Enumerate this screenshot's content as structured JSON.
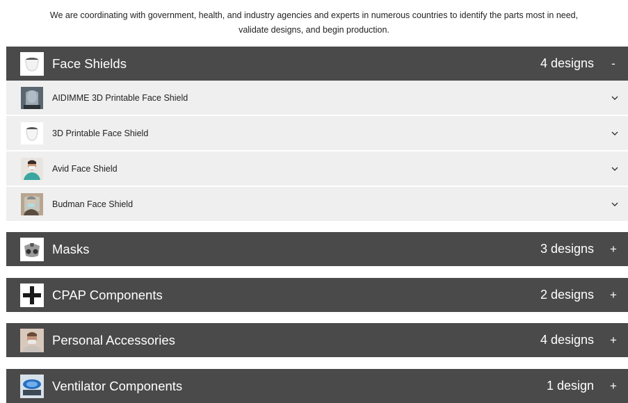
{
  "intro": {
    "line1": "We are coordinating with government, health, and industry agencies and experts in numerous countries to identify the parts most in need,",
    "line2": "validate designs, and begin production."
  },
  "categories": [
    {
      "title": "Face Shields",
      "count": "4 designs",
      "toggle": "-",
      "expanded": true,
      "icon": "face-shield-thumbnail",
      "items": [
        {
          "title": "AIDIMME 3D Printable Face Shield",
          "icon": "person-face-shield-photo"
        },
        {
          "title": "3D Printable Face Shield",
          "icon": "face-shield-thumbnail"
        },
        {
          "title": "Avid Face Shield",
          "icon": "person-mask-photo"
        },
        {
          "title": "Budman Face Shield",
          "icon": "person-face-shield-photo"
        }
      ]
    },
    {
      "title": "Masks",
      "count": "3 designs",
      "toggle": "+",
      "expanded": false,
      "icon": "mask-thumbnail"
    },
    {
      "title": "CPAP Components",
      "count": "2 designs",
      "toggle": "+",
      "expanded": false,
      "icon": "cpap-component-thumbnail"
    },
    {
      "title": "Personal Accessories",
      "count": "4 designs",
      "toggle": "+",
      "expanded": false,
      "icon": "person-accessory-photo"
    },
    {
      "title": "Ventilator Components",
      "count": "1 design",
      "toggle": "+",
      "expanded": false,
      "icon": "ventilator-component-photo"
    }
  ],
  "colors": {
    "header_bg": "#4a4a4a",
    "item_bg": "#efefef",
    "header_text": "#ffffff"
  }
}
